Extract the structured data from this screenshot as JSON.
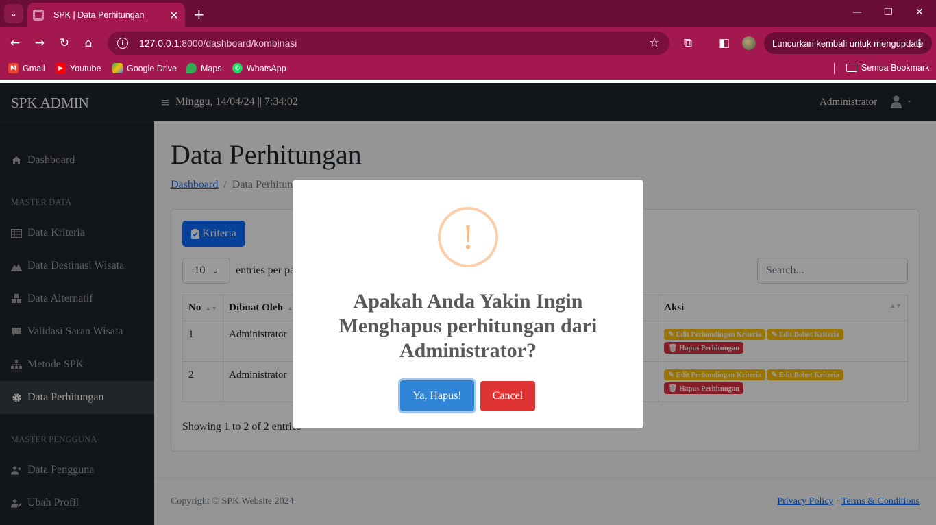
{
  "browser": {
    "tab_title": "SPK | Data Perhitungan",
    "url_host": "127.0.0.1",
    "url_path": ":8000/dashboard/kombinasi",
    "update_button": "Luncurkan kembali untuk mengupdate",
    "bookmarks": [
      "Gmail",
      "Youtube",
      "Google Drive",
      "Maps",
      "WhatsApp"
    ],
    "all_bookmarks": "Semua Bookmark"
  },
  "app": {
    "brand": "SPK ADMIN",
    "clock": "Minggu, 14/04/24 || 7:34:02",
    "user": "Administrator"
  },
  "sidebar": {
    "dashboard": "Dashboard",
    "heading_master_data": "MASTER DATA",
    "kriteria": "Data Kriteria",
    "destinasi": "Data Destinasi Wisata",
    "alternatif": "Data Alternatif",
    "validasi": "Validasi Saran Wisata",
    "metode": "Metode SPK",
    "perhitungan": "Data Perhitungan",
    "heading_master_pengguna": "MASTER PENGGUNA",
    "pengguna": "Data Pengguna",
    "profil": "Ubah Profil"
  },
  "page": {
    "title": "Data Perhitungan",
    "breadcrumb_home": "Dashboard",
    "breadcrumb_current": "Data Perhitungan",
    "kriteria_button": "Kriteria",
    "entries_value": "10",
    "entries_label": "entries per page",
    "search_placeholder": "Search...",
    "showing": "Showing 1 to 2 of 2 entries"
  },
  "table": {
    "headers": {
      "no": "No",
      "created_by": "Dibuat Oleh",
      "action": "Aksi"
    },
    "rows": [
      {
        "no": "1",
        "created_by": "Administrator"
      },
      {
        "no": "2",
        "created_by": "Administrator"
      }
    ],
    "actions": {
      "edit_comparison": "Edit Perbandingan Kriteria",
      "edit_weight": "Edit Bobot Kriteria",
      "delete": "Hapus Perhitungan"
    }
  },
  "footer": {
    "copyright": "Copyright © SPK Website 2024",
    "privacy": "Privacy Policy",
    "separator": "·",
    "terms": "Terms & Conditions"
  },
  "modal": {
    "icon": "!",
    "title": "Apakah Anda Yakin Ingin Menghapus perhitungan dari Administrator?",
    "confirm": "Ya, Hapus!",
    "cancel": "Cancel"
  }
}
